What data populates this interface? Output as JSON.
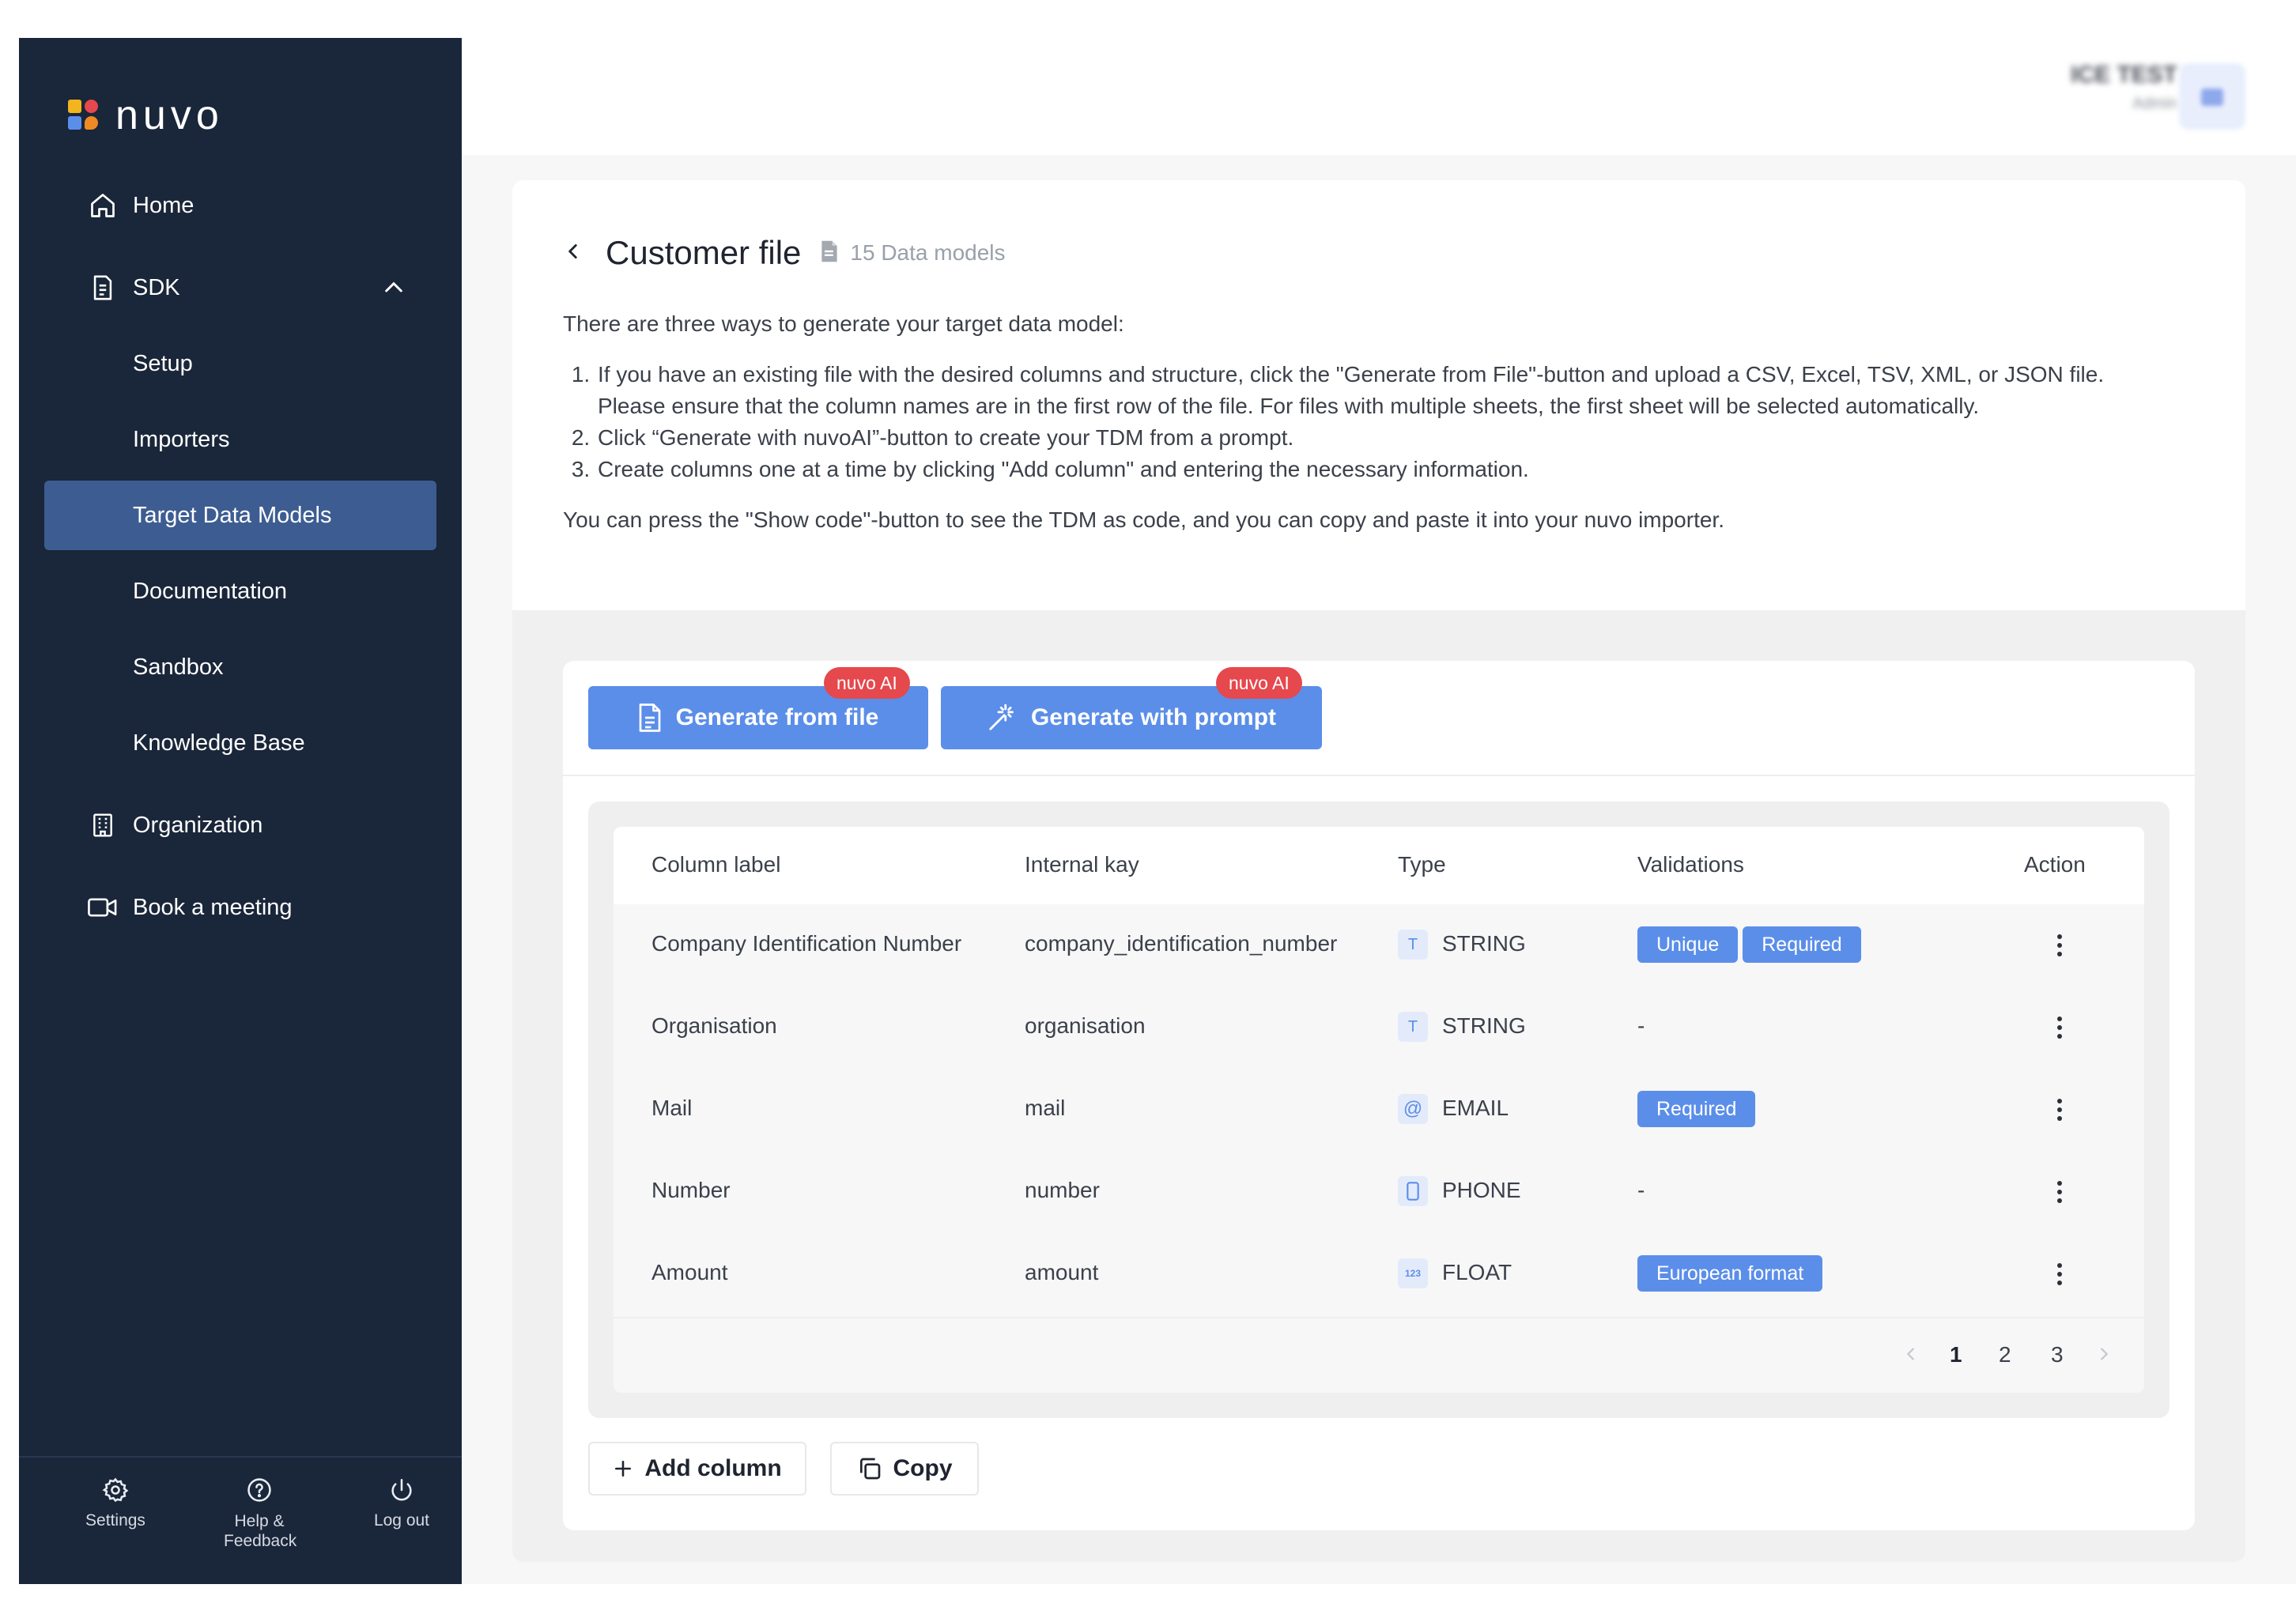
{
  "brand": {
    "name": "nuvo"
  },
  "sidebar": {
    "items": [
      {
        "label": "Home",
        "icon": "home-icon"
      },
      {
        "label": "SDK",
        "icon": "document-icon"
      },
      {
        "label": "Setup"
      },
      {
        "label": "Importers"
      },
      {
        "label": "Target Data Models"
      },
      {
        "label": "Documentation"
      },
      {
        "label": "Sandbox"
      },
      {
        "label": "Knowledge Base"
      },
      {
        "label": "Organization",
        "icon": "building-icon"
      },
      {
        "label": "Book a meeting",
        "icon": "video-icon"
      }
    ],
    "bottom": [
      {
        "label": "Settings",
        "icon": "gear-icon"
      },
      {
        "label": "Help & Feedback",
        "icon": "help-icon"
      },
      {
        "label": "Log out",
        "icon": "power-icon"
      }
    ]
  },
  "header": {
    "user_name": "ICE TEST",
    "user_sub": "Admin"
  },
  "page": {
    "title": "Customer file",
    "count": "15 Data models",
    "intro": "There are three ways to generate your target data model:",
    "steps": [
      "If you have an existing file with the desired columns and structure, click the \"Generate from File\"-button and upload a CSV,  Excel, TSV, XML, or JSON file. Please ensure that the column names are in the first row of the file. For files with multiple sheets, the first sheet will be selected automatically.",
      "Click “Generate with nuvoAI”-button to create your TDM from a prompt.",
      "Create columns one at a time by clicking \"Add column\" and entering the necessary information."
    ],
    "outro": "You can press the \"Show code\"-button to see the TDM as code, and you can copy and paste it into your nuvo importer."
  },
  "actions": {
    "generate_file": "Generate from file",
    "generate_prompt": "Generate with prompt",
    "ai_badge": "nuvo AI",
    "add_column": "Add column",
    "copy": "Copy"
  },
  "table": {
    "headers": [
      "Column label",
      "Internal kay",
      "Type",
      "Validations",
      "Action"
    ],
    "rows": [
      {
        "label": "Company Identification Number",
        "key": "company_identification_number",
        "type_icon": "T",
        "type": "STRING",
        "validations": [
          "Unique",
          "Required"
        ]
      },
      {
        "label": "Organisation",
        "key": "organisation",
        "type_icon": "T",
        "type": "STRING",
        "validations": "-"
      },
      {
        "label": "Mail",
        "key": "mail",
        "type_icon": "@",
        "type": "EMAIL",
        "validations": [
          "Required"
        ]
      },
      {
        "label": "Number",
        "key": "number",
        "type_icon": "phone-icon",
        "type": "PHONE",
        "validations": "-"
      },
      {
        "label": "Amount",
        "key": "amount",
        "type_icon": "123",
        "type": "FLOAT",
        "validations": [
          "European format"
        ]
      }
    ],
    "pagination": {
      "pages": [
        "1",
        "2",
        "3"
      ],
      "current": "1"
    }
  },
  "colors": {
    "sidebar_bg": "#1a2639",
    "sidebar_active": "#3d5d92",
    "accent": "#5b8ee9",
    "badge": "#e5484d"
  }
}
